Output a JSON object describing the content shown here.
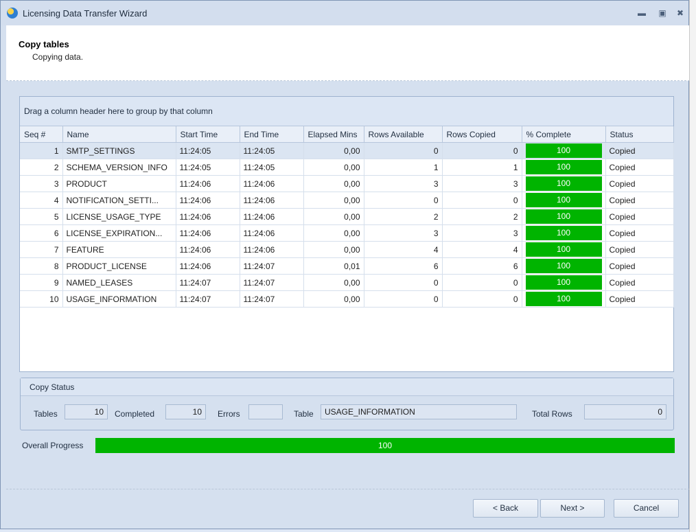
{
  "window": {
    "title": "Licensing Data Transfer Wizard",
    "icon": "globe-icon"
  },
  "header": {
    "title": "Copy tables",
    "subtitle": "Copying data."
  },
  "grid": {
    "group_hint": "Drag a column header here to group by that column",
    "columns": [
      "Seq #",
      "Name",
      "Start Time",
      "End Time",
      "Elapsed Mins",
      "Rows Available",
      "Rows Copied",
      "% Complete",
      "Status"
    ],
    "rows": [
      {
        "seq": "1",
        "name": "SMTP_SETTINGS",
        "start": "11:24:05",
        "end": "11:24:05",
        "elapsed": "0,00",
        "available": "0",
        "copied": "0",
        "pct": "100",
        "status": "Copied"
      },
      {
        "seq": "2",
        "name": "SCHEMA_VERSION_INFO",
        "start": "11:24:05",
        "end": "11:24:05",
        "elapsed": "0,00",
        "available": "1",
        "copied": "1",
        "pct": "100",
        "status": "Copied"
      },
      {
        "seq": "3",
        "name": "PRODUCT",
        "start": "11:24:06",
        "end": "11:24:06",
        "elapsed": "0,00",
        "available": "3",
        "copied": "3",
        "pct": "100",
        "status": "Copied"
      },
      {
        "seq": "4",
        "name": "NOTIFICATION_SETTI...",
        "start": "11:24:06",
        "end": "11:24:06",
        "elapsed": "0,00",
        "available": "0",
        "copied": "0",
        "pct": "100",
        "status": "Copied"
      },
      {
        "seq": "5",
        "name": "LICENSE_USAGE_TYPE",
        "start": "11:24:06",
        "end": "11:24:06",
        "elapsed": "0,00",
        "available": "2",
        "copied": "2",
        "pct": "100",
        "status": "Copied"
      },
      {
        "seq": "6",
        "name": "LICENSE_EXPIRATION...",
        "start": "11:24:06",
        "end": "11:24:06",
        "elapsed": "0,00",
        "available": "3",
        "copied": "3",
        "pct": "100",
        "status": "Copied"
      },
      {
        "seq": "7",
        "name": "FEATURE",
        "start": "11:24:06",
        "end": "11:24:06",
        "elapsed": "0,00",
        "available": "4",
        "copied": "4",
        "pct": "100",
        "status": "Copied"
      },
      {
        "seq": "8",
        "name": "PRODUCT_LICENSE",
        "start": "11:24:06",
        "end": "11:24:07",
        "elapsed": "0,01",
        "available": "6",
        "copied": "6",
        "pct": "100",
        "status": "Copied"
      },
      {
        "seq": "9",
        "name": "NAMED_LEASES",
        "start": "11:24:07",
        "end": "11:24:07",
        "elapsed": "0,00",
        "available": "0",
        "copied": "0",
        "pct": "100",
        "status": "Copied"
      },
      {
        "seq": "10",
        "name": "USAGE_INFORMATION",
        "start": "11:24:07",
        "end": "11:24:07",
        "elapsed": "0,00",
        "available": "0",
        "copied": "0",
        "pct": "100",
        "status": "Copied"
      }
    ]
  },
  "copy_status": {
    "title": "Copy Status",
    "tables_label": "Tables",
    "tables_value": "10",
    "completed_label": "Completed",
    "completed_value": "10",
    "errors_label": "Errors",
    "errors_value": "",
    "table_label": "Table",
    "table_value": "USAGE_INFORMATION",
    "total_rows_label": "Total Rows",
    "total_rows_value": "0"
  },
  "progress": {
    "label": "Overall Progress",
    "value": "100"
  },
  "buttons": {
    "back": "< Back",
    "next": "Next >",
    "cancel": "Cancel"
  },
  "colors": {
    "progress": "#00b400",
    "window_bg": "#d5e0ef"
  }
}
